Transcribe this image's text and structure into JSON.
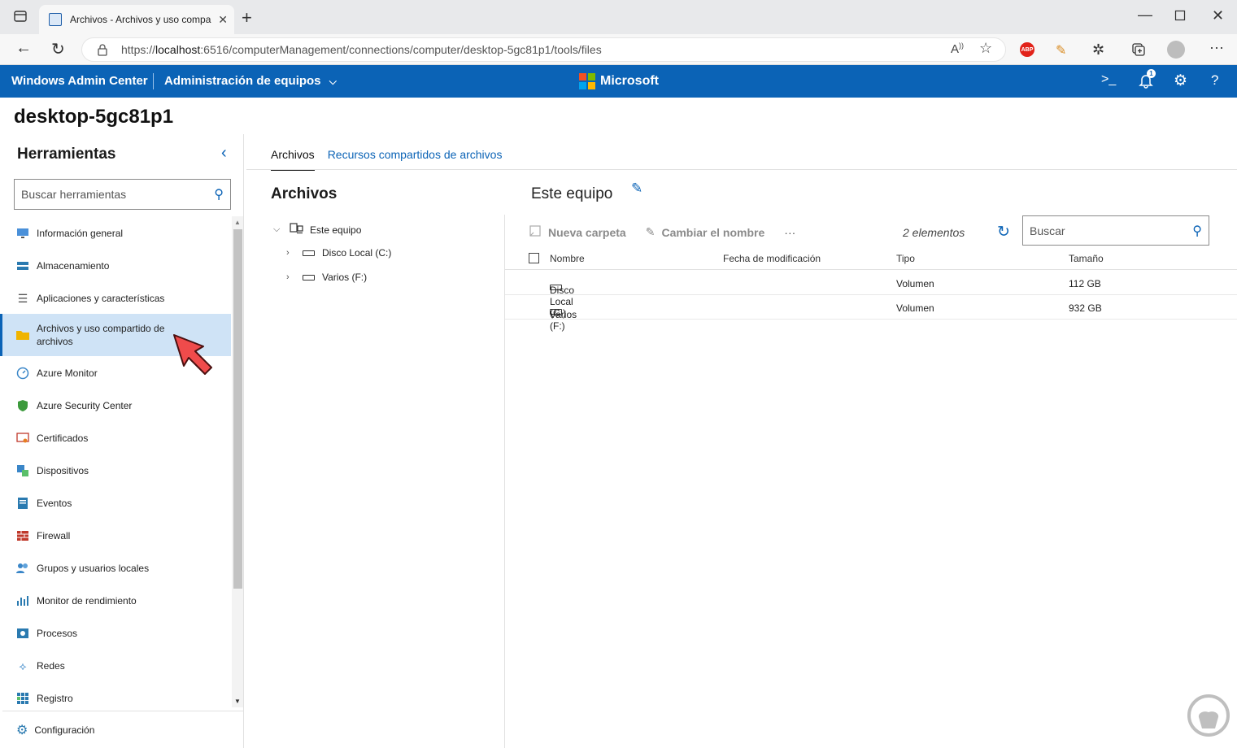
{
  "browser": {
    "tab_title": "Archivos - Archivos y uso compa",
    "url_scheme": "https://",
    "url_host": "localhost",
    "url_rest": ":6516/computerManagement/connections/computer/desktop-5gc81p1/tools/files",
    "icons": [
      "sidebar-toggle-icon",
      "close-tab-icon",
      "new-tab-icon",
      "minimize-icon",
      "maximize-icon",
      "close-window-icon",
      "back-icon",
      "refresh-icon",
      "lock-icon",
      "read-aloud-icon",
      "favorite-icon",
      "adblock-icon",
      "extension-icon",
      "collections-icon",
      "profile-icon",
      "more-icon"
    ],
    "adblock_label": "ABP"
  },
  "wac": {
    "brand": "Windows Admin Center",
    "mgmt": "Administración de equipos",
    "microsoft": "Microsoft",
    "notif_count": "1",
    "colors": {
      "header": "#0b63b6",
      "ms_red": "#f25022",
      "ms_green": "#7fba00",
      "ms_blue": "#00a4ef",
      "ms_yellow": "#ffb900"
    }
  },
  "page_title": "desktop-5gc81p1",
  "sidebar": {
    "heading": "Herramientas",
    "search_placeholder": "Buscar herramientas",
    "items": [
      {
        "label": "Información general",
        "icon": "monitor-icon"
      },
      {
        "label": "Almacenamiento",
        "icon": "storage-icon"
      },
      {
        "label": "Aplicaciones y características",
        "icon": "apps-list-icon"
      },
      {
        "label": "Archivos y uso compartido de archivos",
        "icon": "folder-icon",
        "selected": true
      },
      {
        "label": "Azure Monitor",
        "icon": "gauge-icon"
      },
      {
        "label": "Azure Security Center",
        "icon": "shield-icon"
      },
      {
        "label": "Certificados",
        "icon": "certificate-icon"
      },
      {
        "label": "Dispositivos",
        "icon": "devices-icon"
      },
      {
        "label": "Eventos",
        "icon": "events-icon"
      },
      {
        "label": "Firewall",
        "icon": "firewall-icon"
      },
      {
        "label": "Grupos y usuarios locales",
        "icon": "users-icon"
      },
      {
        "label": "Monitor de rendimiento",
        "icon": "chart-icon"
      },
      {
        "label": "Procesos",
        "icon": "processes-icon"
      },
      {
        "label": "Redes",
        "icon": "network-icon"
      },
      {
        "label": "Registro",
        "icon": "registry-icon"
      }
    ],
    "settings_label": "Configuración"
  },
  "main": {
    "tabs": [
      "Archivos",
      "Recursos compartidos de archivos"
    ],
    "tree_title": "Archivos",
    "tree": {
      "root": "Este equipo",
      "children": [
        "Disco Local (C:)",
        "Varios (F:)"
      ]
    },
    "location": "Este equipo",
    "toolbar": {
      "new_folder": "Nueva carpeta",
      "rename": "Cambiar el nombre",
      "more": "···"
    },
    "item_count": "2 elementos",
    "search_placeholder": "Buscar",
    "columns": [
      "Nombre",
      "Fecha de modificación",
      "Tipo",
      "Tamaño"
    ],
    "rows": [
      {
        "name": "Disco Local (C:)",
        "modified": "",
        "type": "Volumen",
        "size": "112 GB"
      },
      {
        "name": "Varios (F:)",
        "modified": "",
        "type": "Volumen",
        "size": "932 GB"
      }
    ]
  }
}
